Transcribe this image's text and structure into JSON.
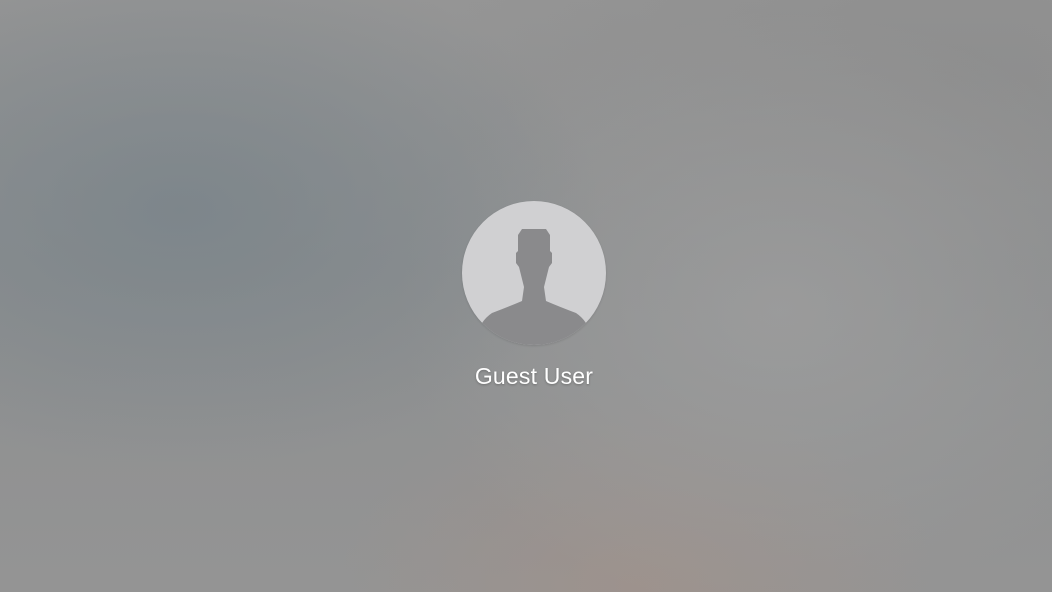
{
  "login_screen": {
    "user": {
      "name": "Guest User",
      "avatar_icon": "user-silhouette-icon"
    }
  },
  "colors": {
    "avatar_background": "#d0d0d2",
    "silhouette": "#8a8a8c",
    "name_text": "#ffffff"
  }
}
